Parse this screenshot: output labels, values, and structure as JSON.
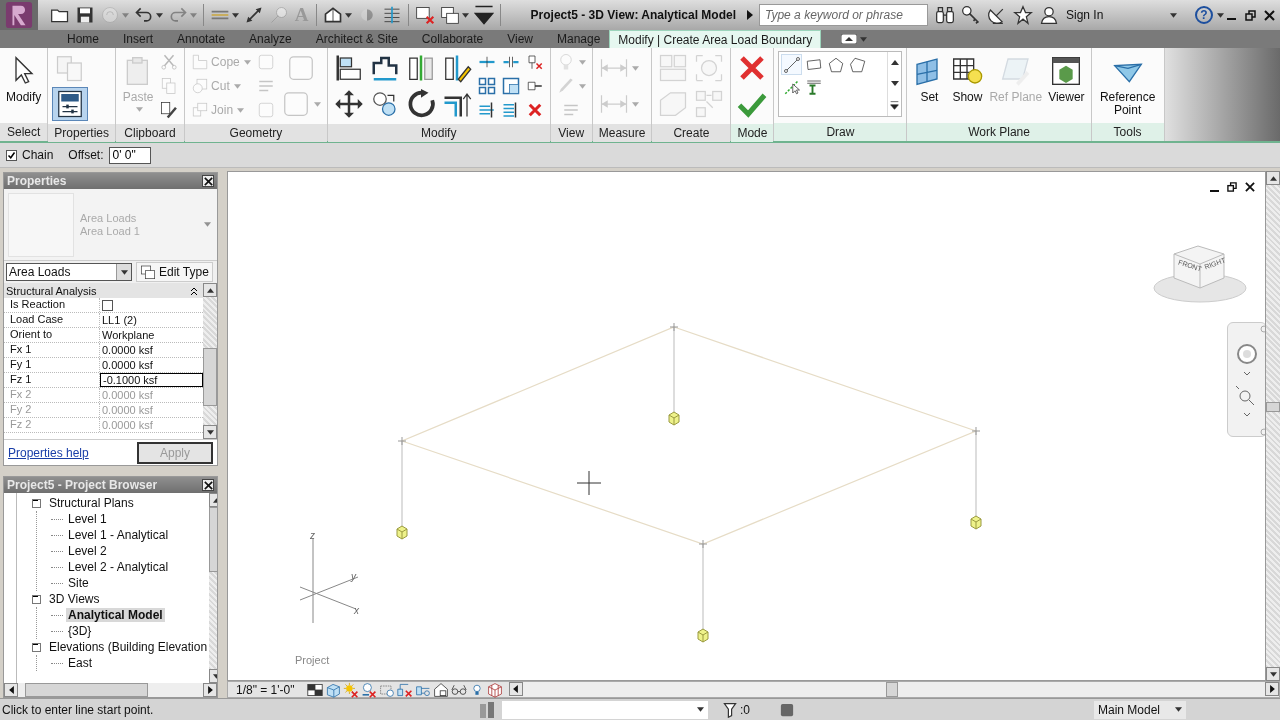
{
  "app": {
    "title": "Project5 - 3D View: Analytical Model",
    "search_placeholder": "Type a keyword or phrase",
    "sign_in": "Sign In",
    "help": "?"
  },
  "quick_access": [
    [
      {
        "kind": "folder",
        "dropdown": false,
        "disabled": false
      },
      {
        "kind": "floppy",
        "dropdown": false,
        "disabled": false
      },
      {
        "kind": "sync",
        "dropdown": true,
        "disabled": true
      },
      {
        "kind": "undo",
        "dropdown": true,
        "disabled": false
      },
      {
        "kind": "redo",
        "dropdown": true,
        "disabled": true
      }
    ],
    [
      {
        "kind": "hdim",
        "dropdown": true,
        "disabled": false
      },
      {
        "kind": "aligned",
        "dropdown": false,
        "disabled": false
      },
      {
        "kind": "tag",
        "dropdown": false,
        "disabled": true
      },
      {
        "kind": "char",
        "text": "A",
        "dropdown": false,
        "disabled": true
      }
    ],
    [
      {
        "kind": "house",
        "dropdown": true,
        "disabled": false
      },
      {
        "kind": "section",
        "dropdown": false,
        "disabled": true
      },
      {
        "kind": "thinlines",
        "dropdown": false,
        "disabled": false
      }
    ],
    [
      {
        "kind": "closewin",
        "dropdown": false,
        "disabled": false
      },
      {
        "kind": "switchwin",
        "dropdown": true,
        "disabled": false
      },
      {
        "kind": "customize",
        "dropdown": false,
        "disabled": false
      }
    ]
  ],
  "tabs": [
    {
      "label": "Home",
      "selected": false
    },
    {
      "label": "Insert",
      "selected": false
    },
    {
      "label": "Annotate",
      "selected": false
    },
    {
      "label": "Analyze",
      "selected": false
    },
    {
      "label": "Architect & Site",
      "selected": false
    },
    {
      "label": "Collaborate",
      "selected": false
    },
    {
      "label": "View",
      "selected": false
    },
    {
      "label": "Manage",
      "selected": false
    },
    {
      "label": "Modify | Create Area Load Boundary",
      "selected": true
    }
  ],
  "ribbon": [
    {
      "title": "Select",
      "kind": "tools",
      "context": false,
      "columns": [
        [
          {
            "kind": "cursor",
            "label": "Modify",
            "disabled": false,
            "on": false,
            "dropdown": false
          }
        ]
      ]
    },
    {
      "title": "Properties",
      "kind": "tools",
      "context": false,
      "columns": [
        [
          {
            "kind": "sheets",
            "disabled": true,
            "on": false,
            "dropdown": false
          },
          {
            "kind": "props",
            "disabled": false,
            "on": true,
            "dropdown": false
          }
        ]
      ]
    },
    {
      "title": "Clipboard",
      "kind": "tools",
      "context": false,
      "columns": [
        [
          {
            "kind": "clipboard",
            "label": "Paste",
            "disabled": true,
            "on": false,
            "dropdown": true
          }
        ],
        [
          {
            "kind": "scissors",
            "disabled": true,
            "on": false,
            "dropdown": false
          },
          {
            "kind": "copy",
            "disabled": true,
            "on": false,
            "dropdown": false
          },
          {
            "kind": "brush",
            "disabled": false,
            "on": false,
            "dropdown": false
          }
        ]
      ]
    },
    {
      "title": "Geometry",
      "kind": "tools",
      "context": false,
      "columns": [
        [
          {
            "kind": "notch",
            "label": "Cope",
            "disabled": true,
            "on": false,
            "dropdown": true
          },
          {
            "kind": "circsq",
            "label": "Cut",
            "disabled": true,
            "on": false,
            "dropdown": true
          },
          {
            "kind": "joined",
            "label": "Join",
            "disabled": true,
            "on": false,
            "dropdown": true
          }
        ],
        [
          {
            "kind": "shape",
            "disabled": true,
            "on": false,
            "dropdown": false
          },
          {
            "kind": "lines",
            "disabled": true,
            "on": false,
            "dropdown": false
          },
          {
            "kind": "shape",
            "disabled": true,
            "on": false,
            "dropdown": false
          }
        ],
        [
          {
            "kind": "shape",
            "disabled": true,
            "on": false,
            "dropdown": false
          },
          {
            "kind": "shape",
            "disabled": true,
            "on": false,
            "dropdown": true
          }
        ]
      ]
    },
    {
      "title": "Modify",
      "kind": "tools",
      "context": false,
      "columns": [
        [
          {
            "kind": "align",
            "disabled": false,
            "on": false,
            "dropdown": false
          },
          {
            "kind": "move",
            "disabled": false,
            "on": false,
            "dropdown": false
          }
        ],
        [
          {
            "kind": "offset",
            "disabled": false,
            "on": false,
            "dropdown": false
          },
          {
            "kind": "copycirc",
            "disabled": false,
            "on": false,
            "dropdown": false
          }
        ],
        [
          {
            "kind": "mirror",
            "disabled": false,
            "on": false,
            "dropdown": false
          },
          {
            "kind": "rotate",
            "disabled": false,
            "on": false,
            "dropdown": false
          }
        ],
        [
          {
            "kind": "mirrorpen",
            "disabled": false,
            "on": false,
            "dropdown": false
          },
          {
            "kind": "corner",
            "disabled": false,
            "on": false,
            "dropdown": false
          }
        ],
        [
          {
            "kind": "split",
            "disabled": false,
            "on": false,
            "dropdown": false
          },
          {
            "kind": "array",
            "disabled": false,
            "on": false,
            "dropdown": false
          },
          {
            "kind": "trim",
            "disabled": false,
            "on": false,
            "dropdown": false
          }
        ],
        [
          {
            "kind": "splitgap",
            "disabled": false,
            "on": false,
            "dropdown": false
          },
          {
            "kind": "scale",
            "disabled": false,
            "on": false,
            "dropdown": false
          },
          {
            "kind": "trimmulti",
            "disabled": false,
            "on": false,
            "dropdown": false
          }
        ],
        [
          {
            "kind": "unpin",
            "disabled": false,
            "on": false,
            "dropdown": false
          },
          {
            "kind": "pin",
            "disabled": false,
            "on": false,
            "dropdown": false
          },
          {
            "kind": "delete",
            "disabled": false,
            "on": false,
            "dropdown": false
          }
        ]
      ]
    },
    {
      "title": "View",
      "kind": "tools",
      "context": false,
      "columns": [
        [
          {
            "kind": "bulb",
            "disabled": true,
            "on": false,
            "dropdown": true
          },
          {
            "kind": "paint",
            "disabled": true,
            "on": false,
            "dropdown": true
          },
          {
            "kind": "lines",
            "disabled": true,
            "on": false,
            "dropdown": false
          }
        ]
      ]
    },
    {
      "title": "Measure",
      "kind": "tools",
      "context": false,
      "columns": [
        [
          {
            "kind": "dimension",
            "disabled": true,
            "on": false,
            "dropdown": true
          },
          {
            "kind": "dimension",
            "disabled": true,
            "on": false,
            "dropdown": true
          }
        ]
      ]
    },
    {
      "title": "Create",
      "kind": "tools",
      "context": false,
      "columns": [
        [
          {
            "kind": "parts",
            "disabled": true,
            "on": false,
            "dropdown": false
          },
          {
            "kind": "assembly",
            "disabled": true,
            "on": false,
            "dropdown": false
          }
        ],
        [
          {
            "kind": "group",
            "disabled": true,
            "on": false,
            "dropdown": false
          },
          {
            "kind": "copyarrow",
            "disabled": true,
            "on": false,
            "dropdown": false
          }
        ]
      ]
    },
    {
      "title": "Mode",
      "kind": "tools",
      "context": true,
      "columns": [
        [
          {
            "kind": "cancel",
            "disabled": false,
            "on": false,
            "dropdown": false
          },
          {
            "kind": "finish",
            "disabled": false,
            "on": false,
            "dropdown": false
          }
        ]
      ]
    },
    {
      "title": "Draw",
      "kind": "gallery",
      "context": true,
      "items": [
        {
          "kind": "line",
          "selected": true
        },
        {
          "kind": "rect",
          "selected": false
        },
        {
          "kind": "pentagon",
          "selected": false
        },
        {
          "kind": "polygon",
          "selected": false
        },
        {
          "kind": "pickline",
          "selected": false
        },
        {
          "kind": "beam",
          "selected": false
        }
      ]
    },
    {
      "title": "Work Plane",
      "kind": "tools",
      "context": true,
      "columns": [
        [
          {
            "kind": "gridplane",
            "label": "Set",
            "disabled": false,
            "on": false,
            "dropdown": false
          }
        ],
        [
          {
            "kind": "gridbulb",
            "label": "Show",
            "disabled": false,
            "on": false,
            "dropdown": false
          }
        ],
        [
          {
            "kind": "planepen",
            "label": "Ref Plane",
            "disabled": true,
            "on": false,
            "dropdown": false
          }
        ],
        [
          {
            "kind": "viewer",
            "label": "Viewer",
            "disabled": false,
            "on": false,
            "dropdown": false
          }
        ]
      ]
    },
    {
      "title": "Tools",
      "kind": "tools",
      "context": true,
      "columns": [
        [
          {
            "kind": "refpoint",
            "label": "Reference Point",
            "disabled": false,
            "on": false,
            "dropdown": false
          }
        ]
      ]
    }
  ],
  "options_bar": {
    "chain": {
      "label": "Chain",
      "checked": true
    },
    "offset": {
      "label": "Offset:",
      "value": "0' 0\""
    }
  },
  "properties": {
    "title": "Properties",
    "type_family": "Area Loads",
    "type_name": "Area Load 1",
    "category": "Area Loads",
    "edit_type": "Edit Type",
    "group": "Structural Analysis",
    "rows": [
      {
        "name": "Is Reaction",
        "kind": "checkbox",
        "checked": false,
        "disabled": false,
        "selected": false
      },
      {
        "name": "Load Case",
        "kind": "text",
        "value": "LL1 (2)",
        "disabled": false,
        "selected": false
      },
      {
        "name": "Orient to",
        "kind": "text",
        "value": "Workplane",
        "disabled": false,
        "selected": false
      },
      {
        "name": "Fx 1",
        "kind": "text",
        "value": "0.0000 ksf",
        "disabled": false,
        "selected": false
      },
      {
        "name": "Fy 1",
        "kind": "text",
        "value": "0.0000 ksf",
        "disabled": false,
        "selected": false
      },
      {
        "name": "Fz 1",
        "kind": "text",
        "value": "-0.1000 ksf",
        "disabled": false,
        "selected": true
      },
      {
        "name": "Fx 2",
        "kind": "text",
        "value": "0.0000 ksf",
        "disabled": true,
        "selected": false
      },
      {
        "name": "Fy 2",
        "kind": "text",
        "value": "0.0000 ksf",
        "disabled": true,
        "selected": false
      },
      {
        "name": "Fz 2",
        "kind": "text",
        "value": "0.0000 ksf",
        "disabled": true,
        "selected": false
      }
    ],
    "help": "Properties help",
    "apply": {
      "label": "Apply",
      "disabled": true
    }
  },
  "browser": {
    "title": "Project5 - Project Browser",
    "tree": [
      {
        "label": "Structural Plans",
        "expanded": true,
        "selected": false,
        "children": [
          {
            "label": "Level 1",
            "selected": false
          },
          {
            "label": "Level 1 - Analytical",
            "selected": false
          },
          {
            "label": "Level 2",
            "selected": false
          },
          {
            "label": "Level 2 - Analytical",
            "selected": false
          },
          {
            "label": "Site",
            "selected": false
          }
        ]
      },
      {
        "label": "3D Views",
        "expanded": true,
        "selected": false,
        "children": [
          {
            "label": "Analytical Model",
            "selected": true
          },
          {
            "label": "{3D}",
            "selected": false
          }
        ]
      },
      {
        "label": "Elevations (Building Elevation",
        "expanded": true,
        "selected": false,
        "children": [
          {
            "label": "East",
            "selected": false
          }
        ]
      }
    ]
  },
  "canvas": {
    "viewcube_faces": [
      "FRONT",
      "RIGHT"
    ],
    "axis_labels": [
      "z",
      "y",
      "x"
    ],
    "view_label": "Project"
  },
  "view_bar": {
    "scale": "1/8\" = 1'-0\"",
    "tools": [
      {
        "kind": "detail"
      },
      {
        "kind": "visual"
      },
      {
        "kind": "sun"
      },
      {
        "kind": "shadow"
      },
      {
        "kind": "crop"
      },
      {
        "kind": "cropshow"
      },
      {
        "kind": "hide"
      },
      {
        "kind": "temp"
      },
      {
        "kind": "reveal"
      },
      {
        "kind": "lightbulb"
      },
      {
        "kind": "analytical"
      }
    ]
  },
  "status_bar": {
    "prompt": "Click to enter line start point.",
    "filter_count": ":0",
    "workset": "Main Model"
  }
}
